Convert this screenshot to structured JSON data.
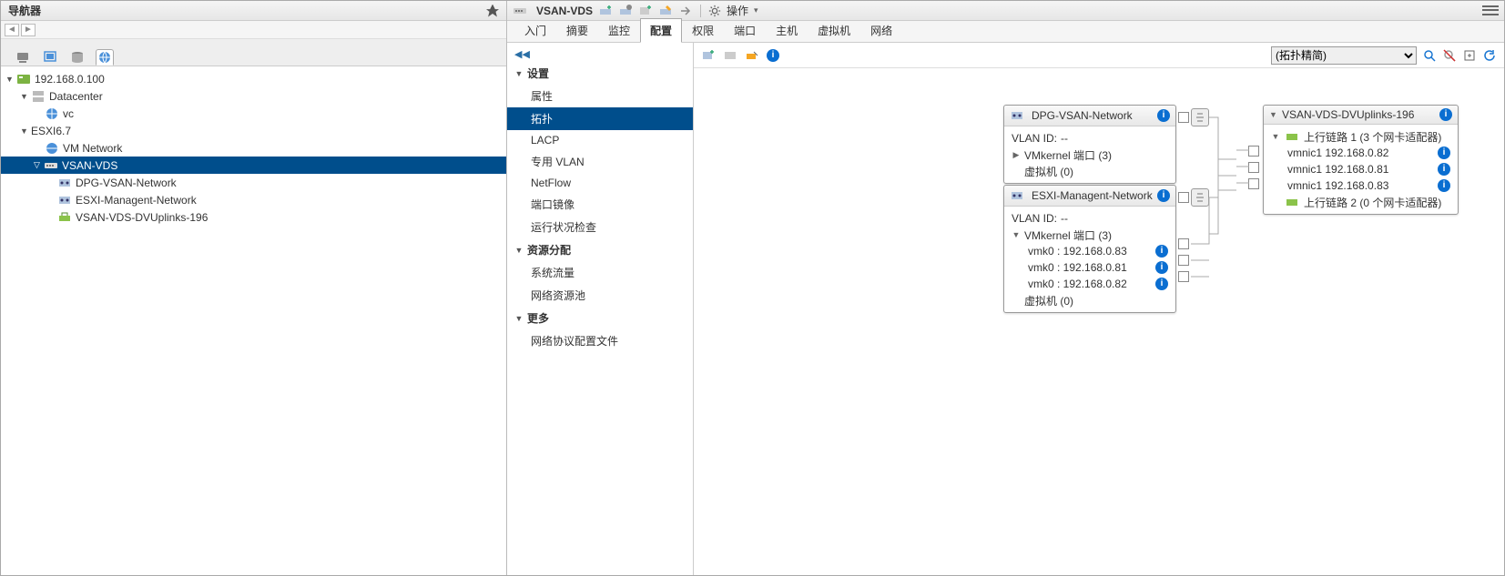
{
  "navigator": {
    "title": "导航器",
    "tree": {
      "root": "192.168.0.100",
      "datacenter": "Datacenter",
      "vc": "vc",
      "esxi": "ESXI6.7",
      "vm_network": "VM Network",
      "vsan_vds": "VSAN-VDS",
      "dpg": "DPG-VSAN-Network",
      "mgmt": "ESXI-Managent-Network",
      "uplinks": "VSAN-VDS-DVUplinks-196"
    }
  },
  "object": {
    "title": "VSAN-VDS",
    "actions_label": "操作"
  },
  "tabs": [
    "入门",
    "摘要",
    "监控",
    "配置",
    "权限",
    "端口",
    "主机",
    "虚拟机",
    "网络"
  ],
  "active_tab": "配置",
  "config_side": {
    "groups": [
      {
        "title": "设置",
        "items": [
          "属性",
          "拓扑",
          "LACP",
          "专用 VLAN",
          "NetFlow",
          "端口镜像",
          "运行状况检查"
        ],
        "selected": "拓扑"
      },
      {
        "title": "资源分配",
        "items": [
          "系统流量",
          "网络资源池"
        ]
      },
      {
        "title": "更多",
        "items": [
          "网络协议配置文件"
        ]
      }
    ]
  },
  "topology": {
    "select_label": "(拓扑精简)",
    "portgroups": [
      {
        "name": "DPG-VSAN-Network",
        "vlan_label": "VLAN ID:",
        "vlan_value": "--",
        "vmk_label": "VMkernel 端口 (3)",
        "vmk_expanded": false,
        "vm_label": "虚拟机 (0)"
      },
      {
        "name": "ESXI-Managent-Network",
        "vlan_label": "VLAN ID:",
        "vlan_value": "--",
        "vmk_label": "VMkernel 端口 (3)",
        "vmk_expanded": true,
        "vmks": [
          {
            "name": "vmk0 :",
            "ip": "192.168.0.83"
          },
          {
            "name": "vmk0 :",
            "ip": "192.168.0.81"
          },
          {
            "name": "vmk0 :",
            "ip": "192.168.0.82"
          }
        ],
        "vm_label": "虚拟机 (0)"
      }
    ],
    "uplinks_card": {
      "name": "VSAN-VDS-DVUplinks-196",
      "uplinks": [
        {
          "title": "上行链路 1 (3 个网卡适配器)",
          "nics": [
            {
              "name": "vmnic1",
              "ip": "192.168.0.82"
            },
            {
              "name": "vmnic1",
              "ip": "192.168.0.81"
            },
            {
              "name": "vmnic1",
              "ip": "192.168.0.83"
            }
          ]
        },
        {
          "title": "上行链路 2 (0 个网卡适配器)"
        }
      ]
    }
  }
}
